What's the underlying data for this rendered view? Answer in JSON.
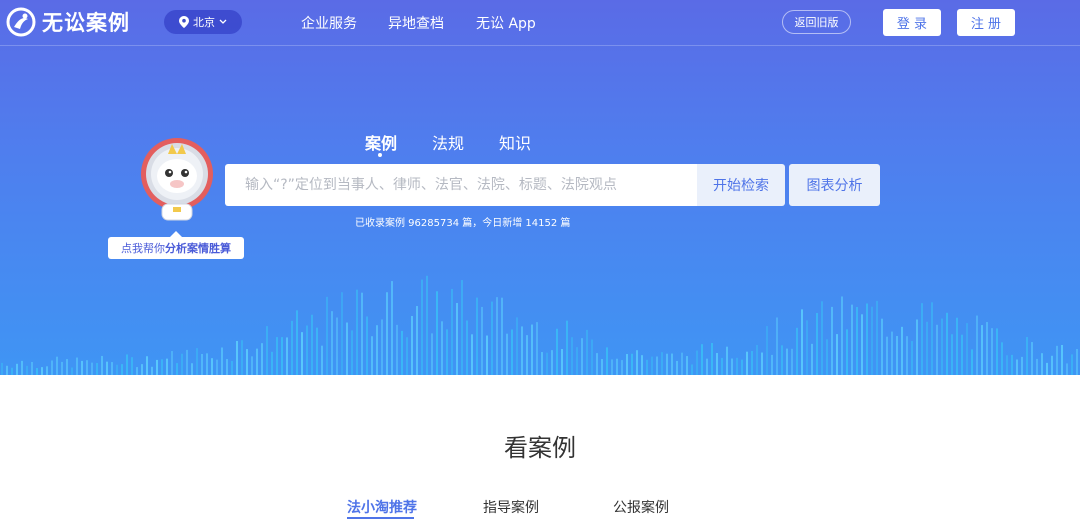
{
  "header": {
    "logo_text": "无讼案例",
    "city": "北京",
    "nav": [
      "企业服务",
      "异地查档",
      "无讼 App"
    ],
    "old_version": "返回旧版",
    "login": "登 录",
    "register": "注 册"
  },
  "search": {
    "tabs": [
      "案例",
      "法规",
      "知识"
    ],
    "active_tab": "案例",
    "placeholder": "输入“?”定位到当事人、律师、法官、法院、标题、法院观点",
    "search_button": "开始检索",
    "chart_button": "图表分析",
    "stats": "已收录案例 96285734 篇，今日新增 14152 篇"
  },
  "mascot": {
    "bubble_prefix": "点我帮你 ",
    "bubble_strong": "分析案情胜算"
  },
  "cases": {
    "title": "看案例",
    "tabs": [
      "法小淘推荐",
      "指导案例",
      "公报案例"
    ],
    "active_tab": "法小淘推荐"
  },
  "colors": {
    "accent": "#4f74e8",
    "hero_top": "#5a6be6",
    "hero_bottom": "#3f95f4"
  }
}
